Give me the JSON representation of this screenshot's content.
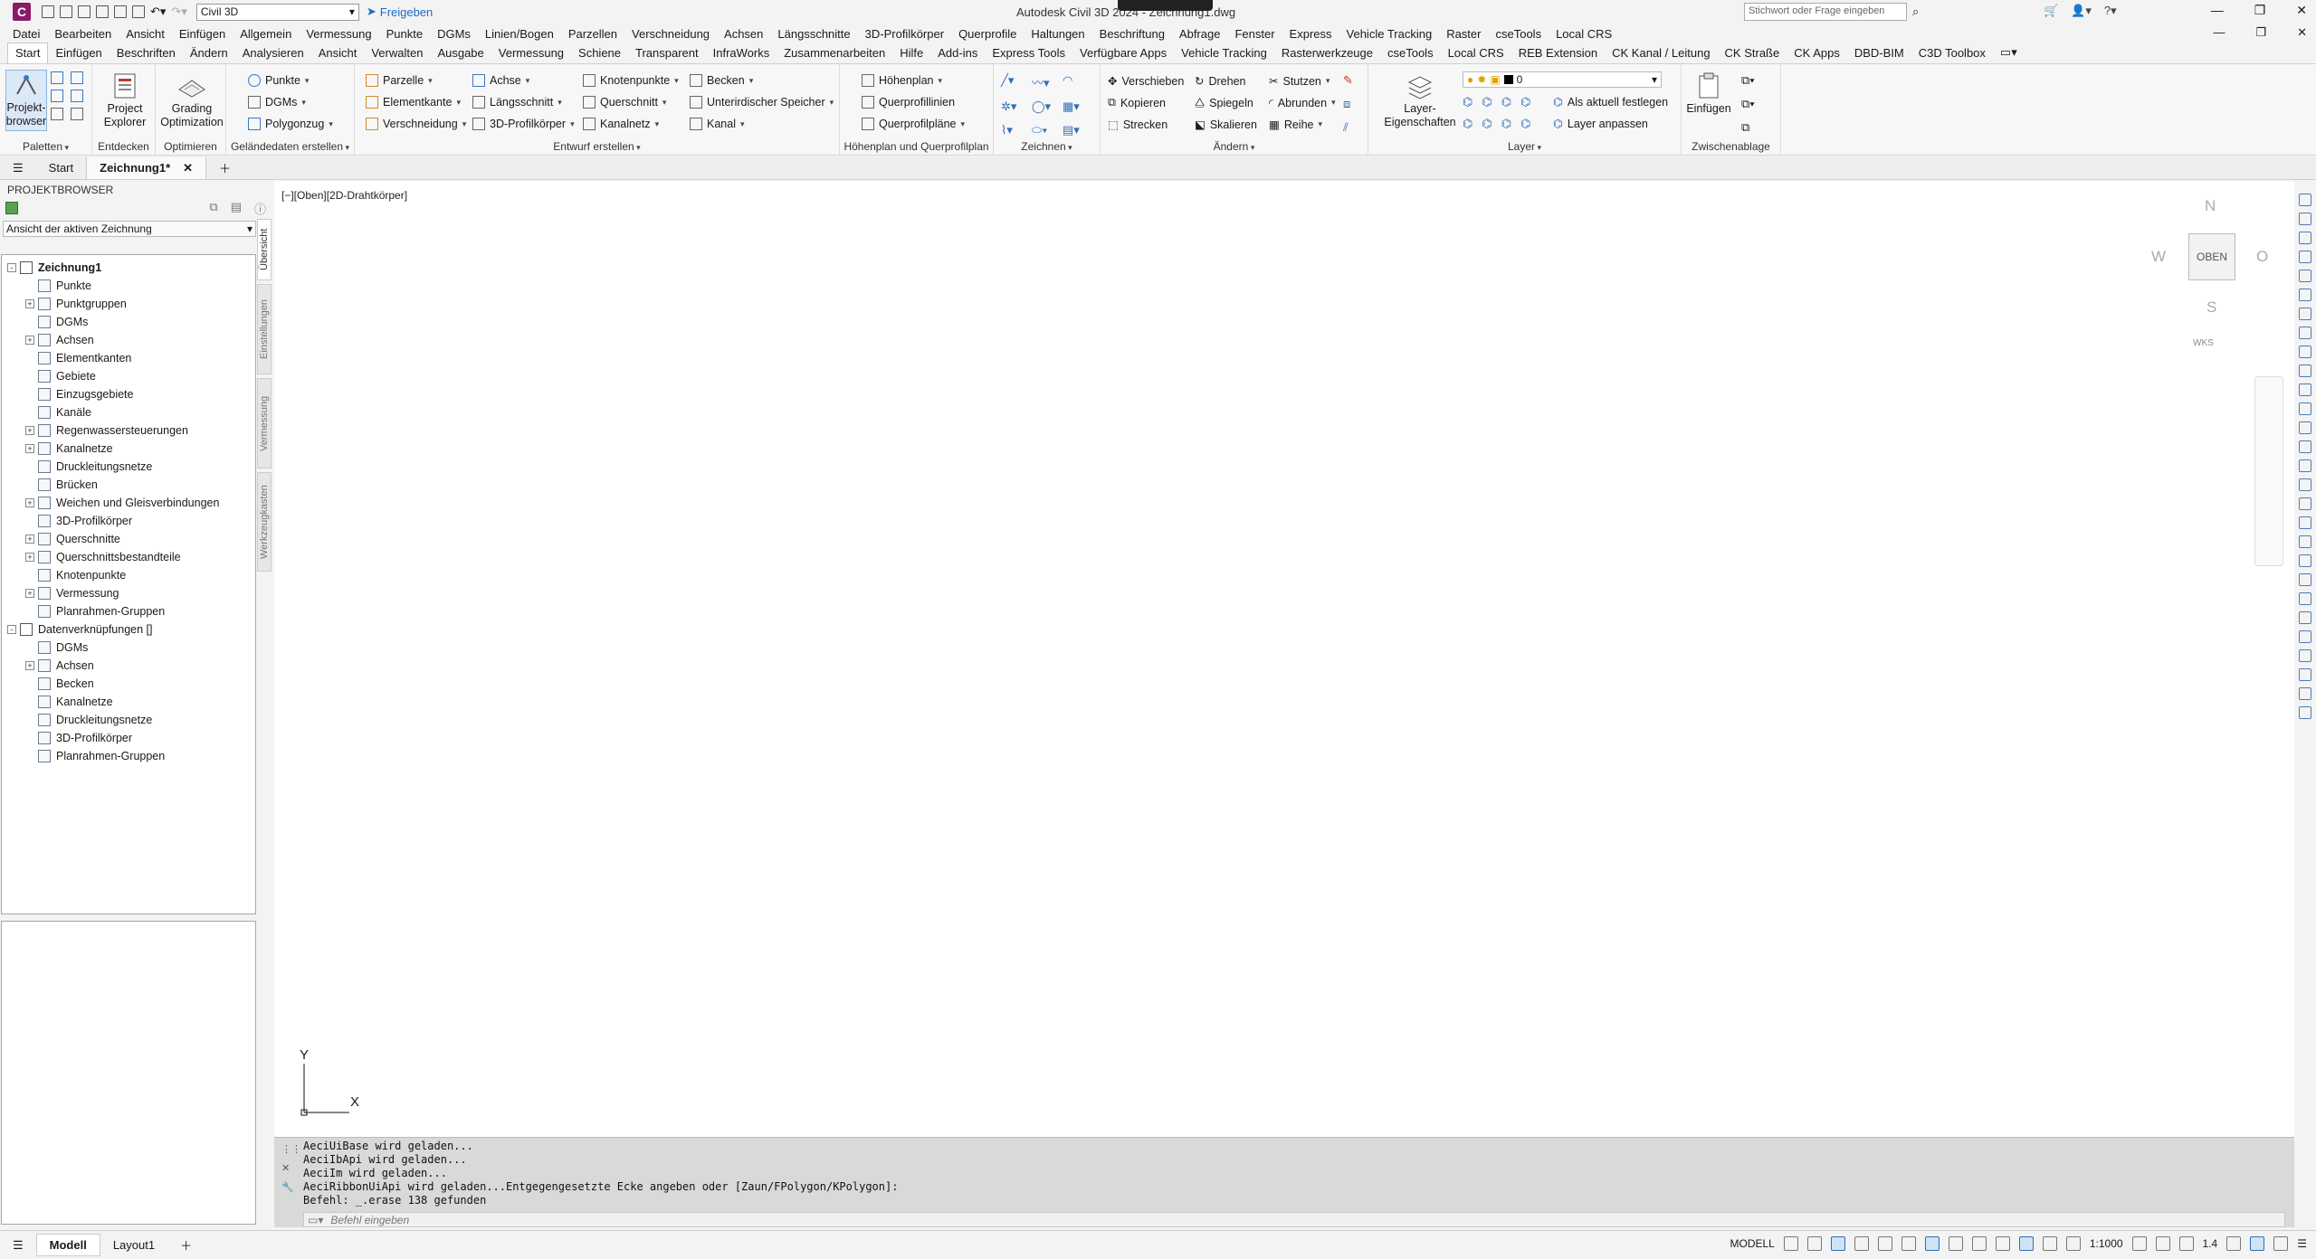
{
  "titlebar": {
    "app_letter": "C",
    "workspace": "Civil 3D",
    "share_label": "Freigeben",
    "window_title": "Autodesk Civil 3D 2024 - Zeichnung1.dwg",
    "search_placeholder": "Stichwort oder Frage eingeben"
  },
  "menubar": [
    "Datei",
    "Bearbeiten",
    "Ansicht",
    "Einfügen",
    "Allgemein",
    "Vermessung",
    "Punkte",
    "DGMs",
    "Linien/Bogen",
    "Parzellen",
    "Verschneidung",
    "Achsen",
    "Längsschnitte",
    "3D-Profilkörper",
    "Querprofile",
    "Haltungen",
    "Beschriftung",
    "Abfrage",
    "Fenster",
    "Express",
    "Vehicle Tracking",
    "Raster",
    "cseTools",
    "Local CRS"
  ],
  "ribbon_tabs": [
    "Start",
    "Einfügen",
    "Beschriften",
    "Ändern",
    "Analysieren",
    "Ansicht",
    "Verwalten",
    "Ausgabe",
    "Vermessung",
    "Schiene",
    "Transparent",
    "InfraWorks",
    "Zusammenarbeiten",
    "Hilfe",
    "Add-ins",
    "Express Tools",
    "Verfügbare Apps",
    "Vehicle Tracking",
    "Rasterwerkzeuge",
    "cseTools",
    "Local CRS",
    "REB Extension",
    "CK Kanal / Leitung",
    "CK Straße",
    "CK Apps",
    "DBD-BIM",
    "C3D Toolbox"
  ],
  "ribbon": {
    "paletten": {
      "label": "Paletten",
      "btn": "Projekt-\nbrowser"
    },
    "entdecken": {
      "label": "Entdecken",
      "btn": "Project\nExplorer"
    },
    "optimieren": {
      "label": "Optimieren",
      "btn": "Grading\nOptimization"
    },
    "gelaende": {
      "label": "Geländedaten erstellen",
      "items": [
        "Punkte",
        "DGMs",
        "Polygonzug"
      ]
    },
    "entwurf": {
      "label": "Entwurf erstellen",
      "items": [
        "Parzelle",
        "Elementkante",
        "Verschneidung",
        "Achse",
        "Längsschnitt",
        "3D-Profilkörper",
        "Knotenpunkte",
        "Querschnitt",
        "Kanalnetz",
        "Becken",
        "Unterirdischer Speicher",
        "Kanal"
      ]
    },
    "hoehenplan": {
      "label": "Höhenplan und Querprofilplan",
      "items": [
        "Höhenplan",
        "Querprofillinien",
        "Querprofilpläne"
      ]
    },
    "zeichnen": {
      "label": "Zeichnen"
    },
    "aendern": {
      "label": "Ändern",
      "items": [
        "Verschieben",
        "Drehen",
        "Stutzen",
        "Kopieren",
        "Spiegeln",
        "Abrunden",
        "Strecken",
        "Skalieren",
        "Reihe"
      ]
    },
    "layer": {
      "label": "Layer",
      "btn": "Layer-\nEigenschaften",
      "current": "0",
      "items": [
        "Als aktuell festlegen",
        "Layer anpassen"
      ]
    },
    "zwischenablage": {
      "label": "Zwischenablage",
      "btn": "Einfügen"
    }
  },
  "doc_tabs": {
    "start": "Start",
    "active": "Zeichnung1*"
  },
  "projektbrowser": {
    "title": "PROJEKTBROWSER",
    "view_select": "Ansicht der aktiven Zeichnung",
    "tree": [
      {
        "label": "Zeichnung1",
        "level": 0,
        "exp": "-",
        "bold": true
      },
      {
        "label": "Punkte",
        "level": 1,
        "exp": ""
      },
      {
        "label": "Punktgruppen",
        "level": 1,
        "exp": "+"
      },
      {
        "label": "DGMs",
        "level": 1,
        "exp": ""
      },
      {
        "label": "Achsen",
        "level": 1,
        "exp": "+"
      },
      {
        "label": "Elementkanten",
        "level": 1,
        "exp": ""
      },
      {
        "label": "Gebiete",
        "level": 1,
        "exp": ""
      },
      {
        "label": "Einzugsgebiete",
        "level": 1,
        "exp": ""
      },
      {
        "label": "Kanäle",
        "level": 1,
        "exp": ""
      },
      {
        "label": "Regenwassersteuerungen",
        "level": 1,
        "exp": "+"
      },
      {
        "label": "Kanalnetze",
        "level": 1,
        "exp": "+"
      },
      {
        "label": "Druckleitungsnetze",
        "level": 1,
        "exp": ""
      },
      {
        "label": "Brücken",
        "level": 1,
        "exp": ""
      },
      {
        "label": "Weichen und Gleisverbindungen",
        "level": 1,
        "exp": "+"
      },
      {
        "label": "3D-Profilkörper",
        "level": 1,
        "exp": ""
      },
      {
        "label": "Querschnitte",
        "level": 1,
        "exp": "+"
      },
      {
        "label": "Querschnittsbestandteile",
        "level": 1,
        "exp": "+"
      },
      {
        "label": "Knotenpunkte",
        "level": 1,
        "exp": ""
      },
      {
        "label": "Vermessung",
        "level": 1,
        "exp": "+"
      },
      {
        "label": "Planrahmen-Gruppen",
        "level": 1,
        "exp": ""
      },
      {
        "label": "Datenverknüpfungen []",
        "level": 0,
        "exp": "-"
      },
      {
        "label": "DGMs",
        "level": 1,
        "exp": ""
      },
      {
        "label": "Achsen",
        "level": 1,
        "exp": "+"
      },
      {
        "label": "Becken",
        "level": 1,
        "exp": ""
      },
      {
        "label": "Kanalnetze",
        "level": 1,
        "exp": ""
      },
      {
        "label": "Druckleitungsnetze",
        "level": 1,
        "exp": ""
      },
      {
        "label": "3D-Profilkörper",
        "level": 1,
        "exp": ""
      },
      {
        "label": "Planrahmen-Gruppen",
        "level": 1,
        "exp": ""
      }
    ],
    "vtabs": [
      "Übersicht",
      "Einstellungen",
      "Vermessung",
      "Werkzeugkasten"
    ]
  },
  "canvas": {
    "view_label": "[−][Oben][2D-Drahtkörper]",
    "compass": {
      "n": "N",
      "s": "S",
      "w": "W",
      "o": "O",
      "center": "OBEN"
    },
    "wks": "WKS",
    "ucs_x": "X",
    "ucs_y": "Y"
  },
  "command": {
    "lines": [
      "AeciUiBase wird geladen...",
      "AeciIbApi wird geladen...",
      "AeciIm wird geladen...",
      "AeciRibbonUiApi wird geladen...Entgegengesetzte Ecke angeben oder [Zaun/FPolygon/KPolygon]:",
      "Befehl: _.erase 138 gefunden"
    ],
    "placeholder": "Befehl eingeben"
  },
  "statusbar": {
    "model": "Modell",
    "layout": "Layout1",
    "mode": "MODELL",
    "scale": "1:1000",
    "annot": "1.4"
  }
}
